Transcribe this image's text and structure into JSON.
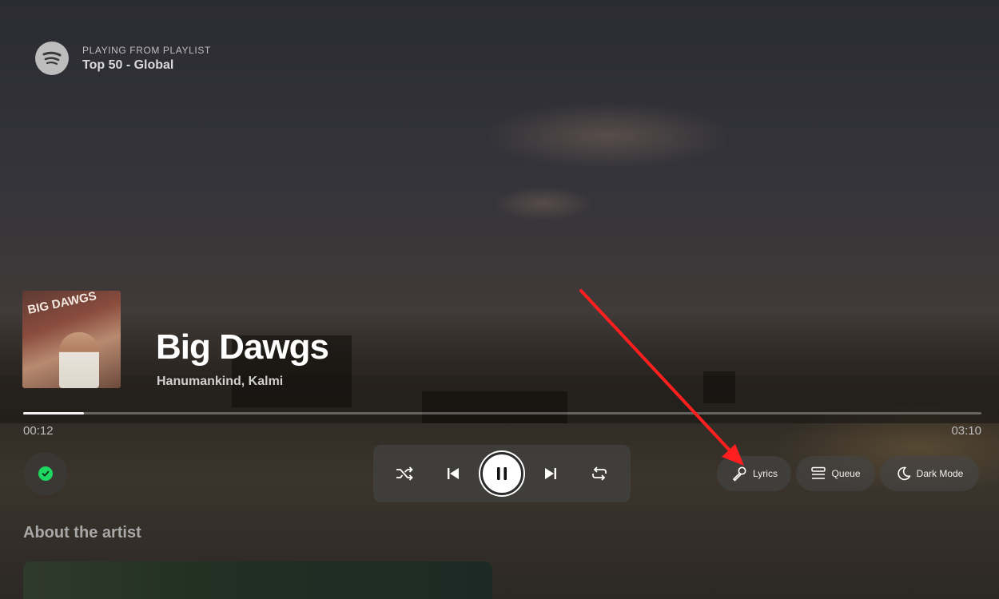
{
  "header": {
    "kicker": "PLAYING FROM PLAYLIST",
    "playlist": "Top 50 - Global"
  },
  "now_playing": {
    "cover_text": "BIG DAWGS",
    "title": "Big Dawgs",
    "artists": "Hanumankind, Kalmi",
    "elapsed": "00:12",
    "duration": "03:10",
    "progress_fraction": 0.063,
    "liked": true,
    "is_playing": true
  },
  "controls": {
    "shuffle_icon": "shuffle-icon",
    "previous_icon": "skip-previous-icon",
    "play_pause_icon": "pause-icon",
    "next_icon": "skip-next-icon",
    "repeat_icon": "repeat-icon"
  },
  "actions": {
    "lyrics_label": "Lyrics",
    "queue_label": "Queue",
    "dark_mode_label": "Dark Mode"
  },
  "about": {
    "title": "About the artist"
  },
  "colors": {
    "accent_green": "#1ed760",
    "annotation_red": "#ff1f1f"
  }
}
